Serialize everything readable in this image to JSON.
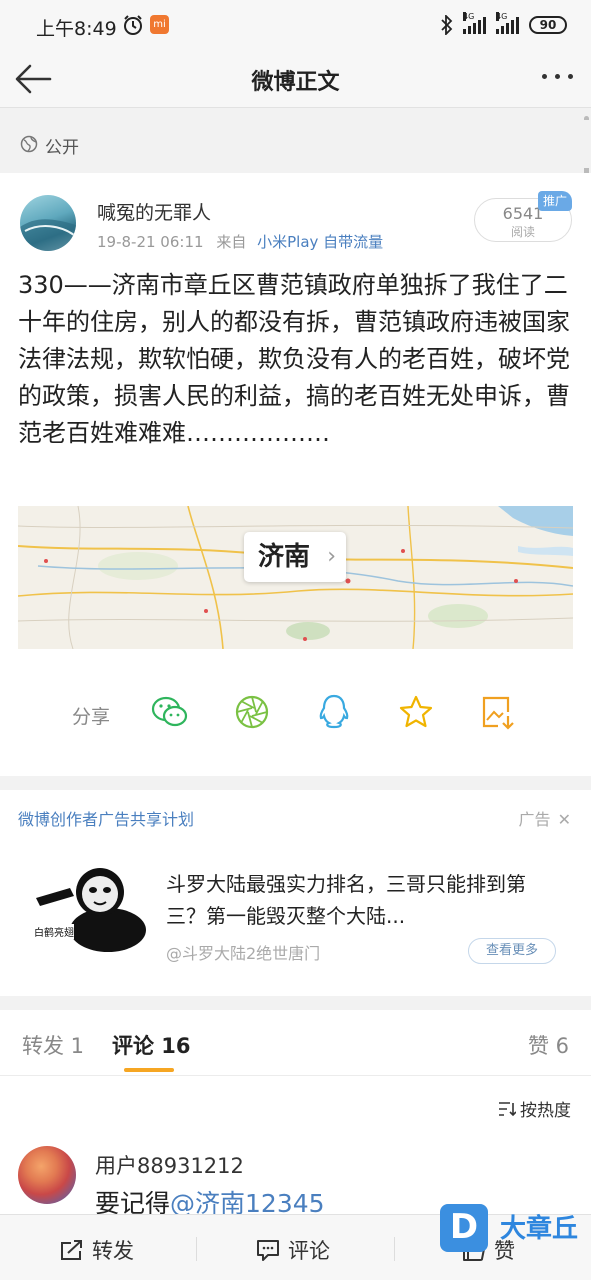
{
  "status_bar": {
    "time": "上午8:49",
    "net1": "4G",
    "net2": "4G",
    "battery": "90"
  },
  "nav": {
    "title": "微博正文"
  },
  "visibility": {
    "label": "公开"
  },
  "post": {
    "author": "喊冤的无罪人",
    "date": "19-8-21 06:11",
    "from_prefix": "来自",
    "source": "小米Play 自带流量",
    "read_count": "6541",
    "read_label": "阅读",
    "promo_badge": "推广",
    "content": "330——济南市章丘区曹范镇政府单独拆了我住了二十年的住房，别人的都没有拆，曹范镇政府违被国家法律法规，欺软怕硬，欺负没有人的老百姓，破坏党的政策，损害人民的利益，搞的老百姓无处申诉，曹范老百姓难难难………………",
    "map": {
      "label": "济南"
    }
  },
  "share": {
    "label": "分享"
  },
  "ad": {
    "program": "微博创作者广告共享计划",
    "tag": "广告",
    "image_caption": "白鹤亮翅",
    "text": "斗罗大陆最强实力排名，三哥只能排到第三？第一能毁灭整个大陆...",
    "source": "@斗罗大陆2绝世唐门",
    "more": "查看更多"
  },
  "tabs": {
    "repost": "转发 1",
    "comment": "评论 16",
    "like": "赞 6"
  },
  "sort": {
    "label": "按热度"
  },
  "comment": {
    "user": "用户88931212",
    "text_prefix": "要记得",
    "mention": "@济南12345"
  },
  "bottom": {
    "repost": "转发",
    "comment": "评论",
    "like": "赞"
  },
  "watermark": {
    "logo": "D",
    "text": "大章丘"
  },
  "colors": {
    "link": "#4a7fbf",
    "accent_underline": "#f6a623",
    "promo": "#6aa9e6",
    "share_wechat": "#2fb55d",
    "share_moments": "#7ac143",
    "share_qq": "#39a9e0",
    "share_star": "#f0b400",
    "share_save": "#f0a020"
  }
}
